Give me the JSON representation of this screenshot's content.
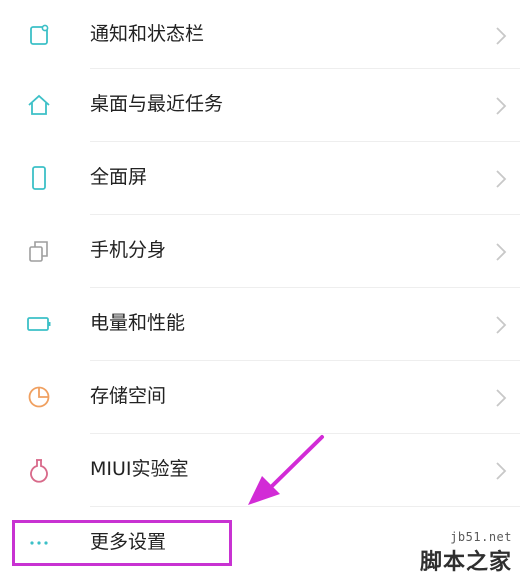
{
  "settings_list": {
    "items": [
      {
        "label": "通知和状态栏",
        "icon": "notification-icon"
      },
      {
        "label": "桌面与最近任务",
        "icon": "home-icon"
      },
      {
        "label": "全面屏",
        "icon": "phone-icon"
      },
      {
        "label": "手机分身",
        "icon": "dual-copy-icon"
      },
      {
        "label": "电量和性能",
        "icon": "battery-icon"
      },
      {
        "label": "存储空间",
        "icon": "storage-pie-icon"
      },
      {
        "label": "MIUI实验室",
        "icon": "flask-icon"
      },
      {
        "label": "更多设置",
        "icon": "more-dots-icon"
      }
    ]
  },
  "watermark": {
    "url": "jb51.net",
    "name": "脚本之家"
  },
  "colors": {
    "icon_teal": "#3cc0c7",
    "icon_gray": "#9e9e9e",
    "icon_orange": "#f0a060",
    "icon_pink": "#d86a8a",
    "highlight": "#c832d2",
    "chevron": "#c8c8c8"
  }
}
